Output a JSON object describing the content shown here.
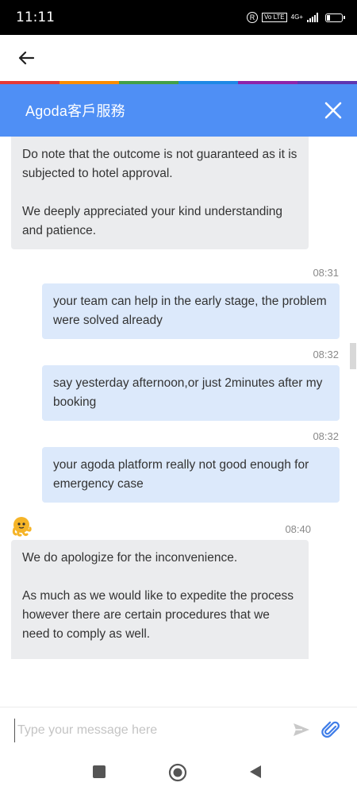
{
  "status_bar": {
    "time": "11:11",
    "r_badge": "R",
    "volte": "Vo LTE",
    "network": "4G+"
  },
  "nav": {
    "back_icon": "arrow-left-icon"
  },
  "rainbow_colors": [
    "#e53935",
    "#fb8c00",
    "#43a047",
    "#1e88e5",
    "#8e24aa",
    "#5e35b1"
  ],
  "chat_header": {
    "title": "Agoda客戶服務",
    "background": "#4f8ff5",
    "close_icon": "close-icon"
  },
  "messages": [
    {
      "sender": "agent",
      "paragraphs": [
        "Do note that the outcome is not guaranteed as it is subjected to hotel approval.",
        "We deeply appreciated your kind understanding and patience."
      ]
    },
    {
      "sender": "user",
      "time": "08:31",
      "paragraphs": [
        "your team can help in the early stage, the problem were solved already"
      ]
    },
    {
      "sender": "user",
      "time": "08:32",
      "paragraphs": [
        "say yesterday afternoon,or just 2minutes after my booking"
      ]
    },
    {
      "sender": "user",
      "time": "08:32",
      "paragraphs": [
        "your agoda platform really not good enough for emergency case"
      ]
    },
    {
      "sender": "agent",
      "time": "08:40",
      "paragraphs": [
        "We do apologize for the inconvenience.",
        "As much as we would like to expedite the process however there are certain procedures that we need to comply as well."
      ]
    }
  ],
  "input": {
    "placeholder": "Type your message here",
    "value": "",
    "send_icon": "send-icon",
    "attach_icon": "paperclip-icon"
  },
  "system_nav": {
    "recents_icon": "square-icon",
    "home_icon": "home-circle-icon",
    "back_icon": "triangle-back-icon"
  }
}
